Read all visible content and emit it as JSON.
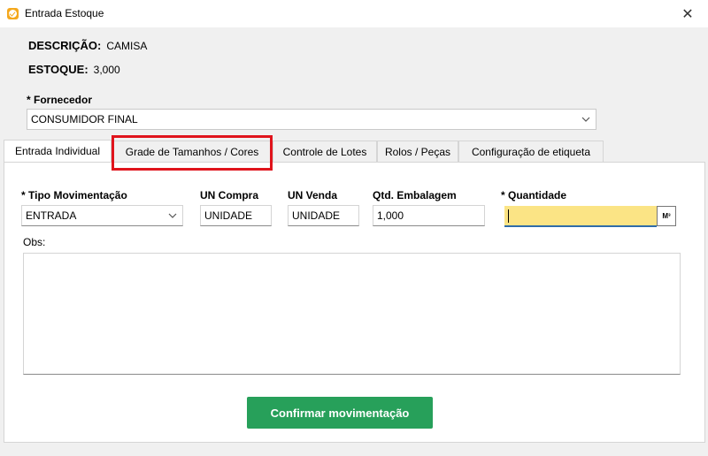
{
  "window": {
    "title": "Entrada Estoque",
    "close_glyph": "✕",
    "icon": "app-check-icon"
  },
  "produto": {
    "descricao_label": "DESCRIÇÃO:",
    "descricao_value": "CAMISA",
    "estoque_label": "ESTOQUE:",
    "estoque_value": "3,000"
  },
  "fornecedor": {
    "label": "* Fornecedor",
    "value": "CONSUMIDOR FINAL"
  },
  "tabs": [
    {
      "label": "Entrada Individual",
      "active": true
    },
    {
      "label": "Grade de Tamanhos / Cores",
      "active": false
    },
    {
      "label": "Controle de Lotes",
      "active": false
    },
    {
      "label": "Rolos / Peças",
      "active": false
    },
    {
      "label": "Configuração de etiqueta",
      "active": false
    }
  ],
  "form": {
    "tipo_mov_label": "* Tipo Movimentação",
    "tipo_mov_value": "ENTRADA",
    "un_compra_label": "UN Compra",
    "un_compra_value": "UNIDADE",
    "un_venda_label": "UN Venda",
    "un_venda_value": "UNIDADE",
    "qtd_emb_label": "Qtd. Embalagem",
    "qtd_emb_value": "1,000",
    "quantidade_label": "* Quantidade",
    "quantidade_value": "",
    "unit_button": "M³",
    "obs_label": "Obs:",
    "obs_value": ""
  },
  "confirm_button": "Confirmar movimentação",
  "colors": {
    "highlight": "#e0141c",
    "confirm": "#27a05a",
    "quantity_bg": "#fbe485"
  }
}
